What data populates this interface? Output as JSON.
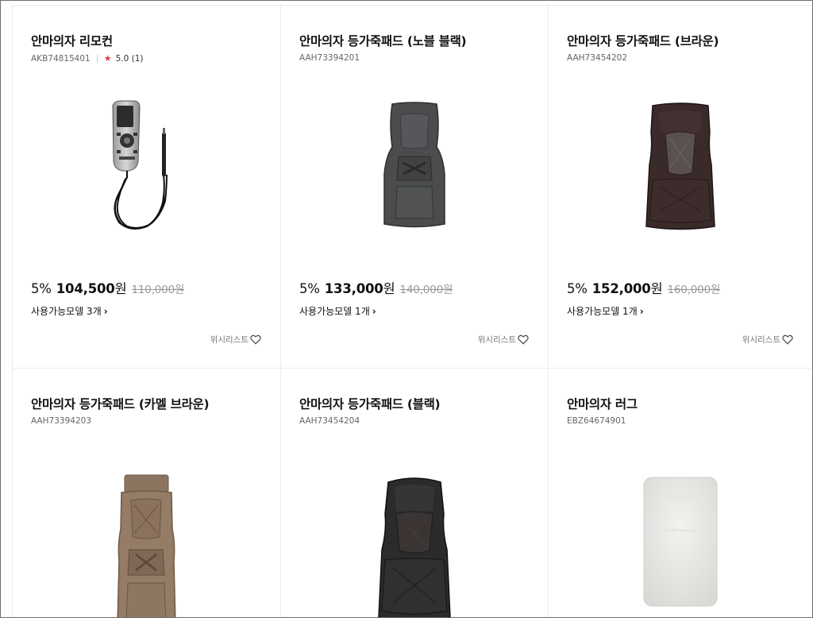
{
  "products": [
    {
      "name": "안마의자 리모컨",
      "code": "AKB74815401",
      "rating": "5.0 (1)",
      "discount": "5%",
      "price": "104,500",
      "price_unit": "원",
      "original_price": "110,000원",
      "compat": "사용가능모델 3개",
      "wishlist": "위시리스트",
      "image": "remote-control"
    },
    {
      "name": "안마의자 등가죽패드 (노블 블랙)",
      "code": "AAH73394201",
      "discount": "5%",
      "price": "133,000",
      "price_unit": "원",
      "original_price": "140,000원",
      "compat": "사용가능모델 1개",
      "wishlist": "위시리스트",
      "image": "back-pad-noble-black"
    },
    {
      "name": "안마의자 등가죽패드 (브라운)",
      "code": "AAH73454202",
      "discount": "5%",
      "price": "152,000",
      "price_unit": "원",
      "original_price": "160,000원",
      "compat": "사용가능모델 1개",
      "wishlist": "위시리스트",
      "image": "back-pad-brown"
    },
    {
      "name": "안마의자 등가죽패드 (카멜 브라운)",
      "code": "AAH73394203",
      "image": "back-pad-camel-brown"
    },
    {
      "name": "안마의자 등가죽패드 (블랙)",
      "code": "AAH73454204",
      "image": "back-pad-black"
    },
    {
      "name": "안마의자 러그",
      "code": "EBZ64674901",
      "image": "rug"
    }
  ],
  "colors": {
    "star": "#e63946",
    "strike": "#999999",
    "divider": "#ececec"
  },
  "icons": {
    "star": "star-icon",
    "chevron": "chevron-right-icon",
    "heart": "heart-icon"
  },
  "chevron_glyph": "›"
}
